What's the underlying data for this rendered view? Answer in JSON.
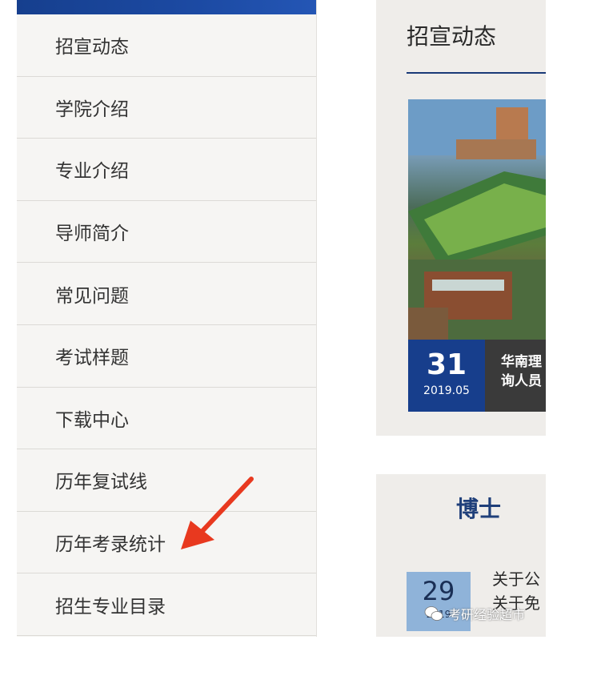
{
  "sidebar": {
    "items": [
      {
        "label": "招宣动态"
      },
      {
        "label": "学院介绍"
      },
      {
        "label": "专业介绍"
      },
      {
        "label": "导师简介"
      },
      {
        "label": "常见问题"
      },
      {
        "label": "考试样题"
      },
      {
        "label": "下载中心"
      },
      {
        "label": "历年复试线"
      },
      {
        "label": "历年考录统计"
      },
      {
        "label": "招生专业目录"
      }
    ]
  },
  "news": {
    "title": "招宣动态",
    "day": "31",
    "year_month": "2019.05",
    "caption_line1": "华南理",
    "caption_line2": "询人员"
  },
  "phd": {
    "title": "博士",
    "day": "29",
    "year_month": "2019",
    "caption_line1": "关于公",
    "caption_line2": "关于免"
  },
  "watermark": {
    "text": "考研经验超市"
  },
  "colors": {
    "accent": "#173e8c",
    "arrow": "#e8391f"
  }
}
